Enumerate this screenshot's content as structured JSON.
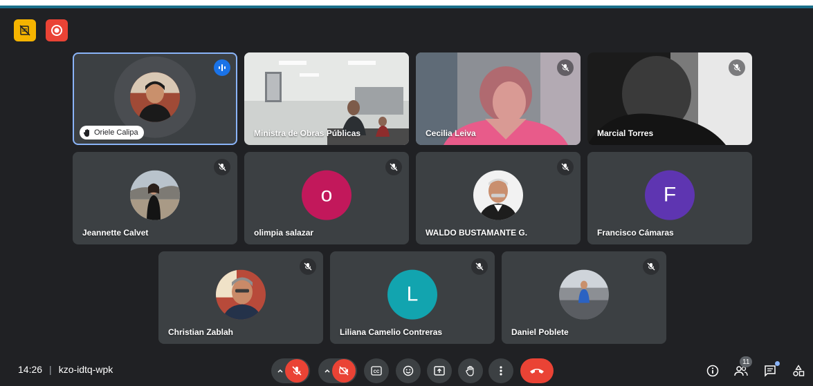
{
  "meeting": {
    "time": "14:26",
    "code": "kzo-idtq-wpk"
  },
  "colors": {
    "background": "#202124",
    "tile": "#3c4043",
    "active_outline": "#8ab4f8",
    "danger": "#ea4335",
    "notes": "#f5b400"
  },
  "status_icons": [
    {
      "name": "notes-off-icon",
      "color": "#f5b400"
    },
    {
      "name": "recording-icon",
      "color": "#ea4335"
    }
  ],
  "participants": [
    {
      "name": "Oriele Calipa",
      "type": "speaking",
      "avatar": "photo"
    },
    {
      "name": "Ministra de Obras Públicas",
      "type": "video"
    },
    {
      "name": "Cecilia Leiva",
      "type": "video",
      "muted": true
    },
    {
      "name": "Marcial Torres",
      "type": "video",
      "muted": true
    },
    {
      "name": "Jeannette Calvet",
      "type": "photo",
      "muted": true
    },
    {
      "name": "olimpia salazar",
      "type": "letter",
      "letter": "o",
      "color": "#c2185b",
      "muted": true
    },
    {
      "name": "WALDO BUSTAMANTE G.",
      "type": "photo",
      "muted": true
    },
    {
      "name": "Francisco Cámaras",
      "type": "letter",
      "letter": "F",
      "color": "#5e35b1",
      "muted": true
    },
    {
      "name": "Christian Zablah",
      "type": "photo",
      "muted": true
    },
    {
      "name": "Liliana Camelio Contreras",
      "type": "letter",
      "letter": "L",
      "color": "#12a4af",
      "muted": true
    },
    {
      "name": "Daniel Poblete",
      "type": "photo",
      "muted": true
    }
  ],
  "participant_count": "11",
  "controls": [
    "mic-off-button",
    "camera-off-button",
    "captions-button",
    "reactions-button",
    "present-button",
    "raise-hand-button",
    "more-options-button",
    "leave-call-button"
  ]
}
